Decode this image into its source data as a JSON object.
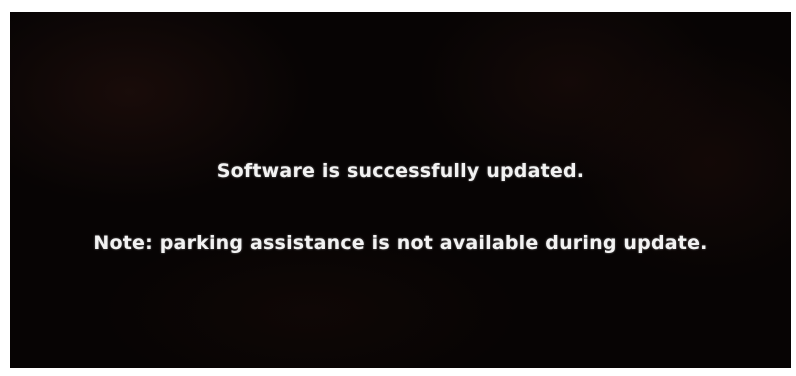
{
  "screen": {
    "status_message": "Software is successfully updated.",
    "note_message": "Note: parking assistance is not available during update."
  },
  "colors": {
    "background": "#070404",
    "text": "#f2f2f2"
  }
}
